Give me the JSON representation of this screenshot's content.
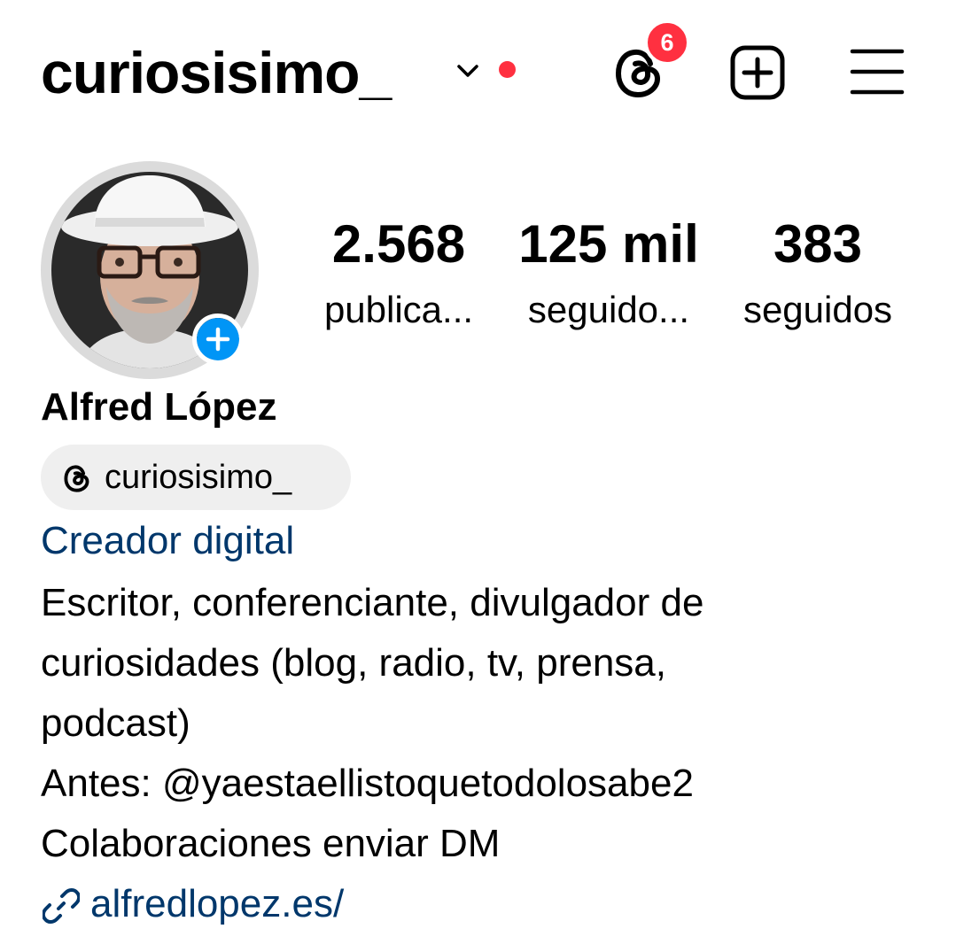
{
  "colors": {
    "accent_red": "#ff3040",
    "link_blue": "#00376b",
    "story_add_blue": "#0095f6",
    "chip_bg": "#efefef"
  },
  "header": {
    "username": "curiosisimo_",
    "icons": [
      "chevron-down-icon",
      "threads-icon",
      "new-post-icon",
      "menu-icon"
    ],
    "threads_badge": "6"
  },
  "stats": [
    {
      "value": "2.568",
      "label": "publica..."
    },
    {
      "value": "125 mil",
      "label": "seguido..."
    },
    {
      "value": "383",
      "label": "seguidos"
    }
  ],
  "profile": {
    "full_name": "Alfred López",
    "threads_handle": "curiosisimo_",
    "category": "Creador digital",
    "bio_lines": [
      "Escritor, conferenciante, divulgador de",
      "curiosidades (blog, radio, tv, prensa,",
      "podcast)",
      "Antes: @yaestaellistoquetodolosabe2",
      "Colaboraciones enviar DM"
    ],
    "link": "alfredlopez.es/"
  }
}
